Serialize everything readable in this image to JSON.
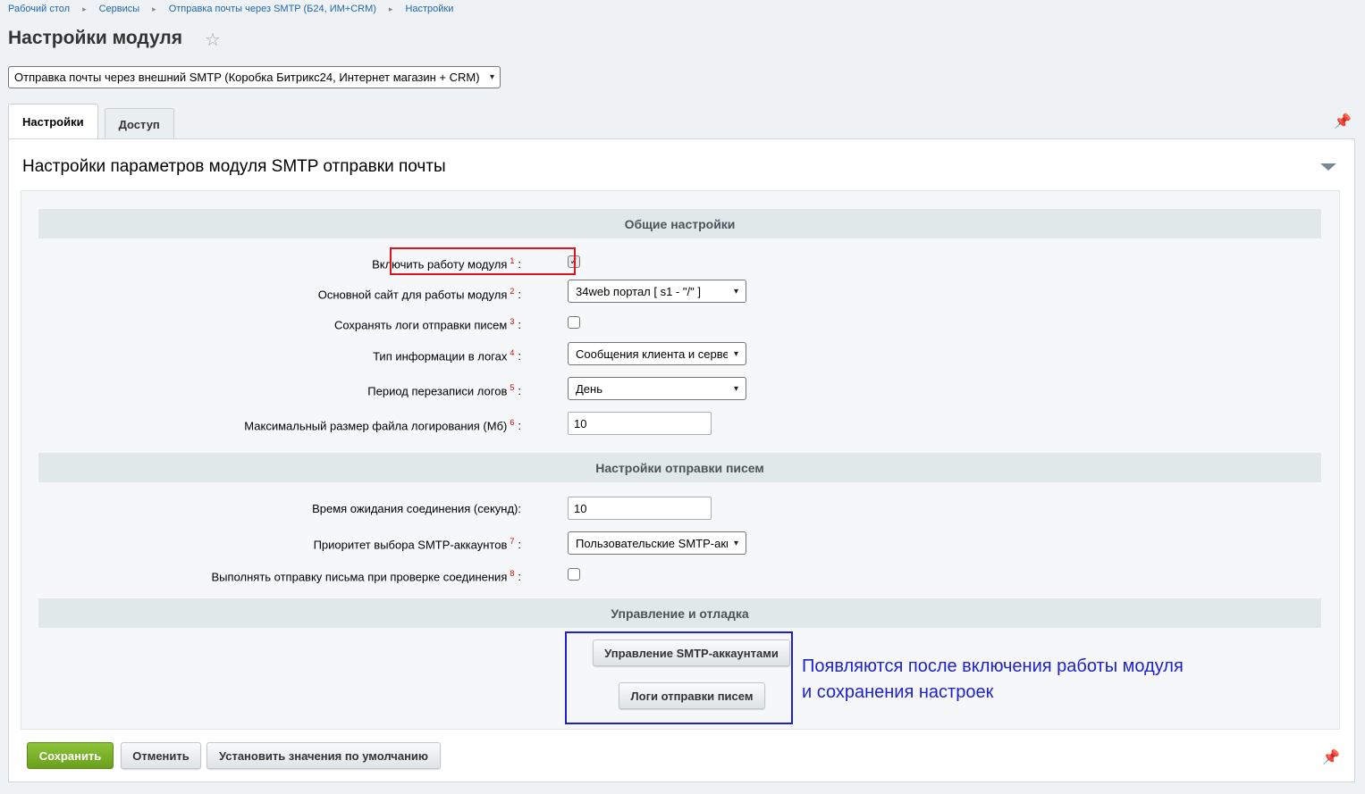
{
  "breadcrumb": {
    "items": [
      "Рабочий стол",
      "Сервисы",
      "Отправка почты через SMTP (Б24, ИМ+CRM)",
      "Настройки"
    ],
    "separator": "▸"
  },
  "page": {
    "title": "Настройки модуля",
    "favorite_icon": "star-icon"
  },
  "module_select": {
    "value": "Отправка почты через внешний SMTP (Коробка Битрикс24, Интернет магазин + CRM)"
  },
  "tabs": [
    {
      "label": "Настройки",
      "active": true
    },
    {
      "label": "Доступ",
      "active": false
    }
  ],
  "panel": {
    "title": "Настройки параметров модуля SMTP отправки почты"
  },
  "sections": {
    "general": "Общие настройки",
    "sending": "Настройки отправки писем",
    "management": "Управление и отладка"
  },
  "fields": {
    "enable": {
      "label": "Включить работу модуля",
      "note": "1",
      "checked": true
    },
    "site": {
      "label": "Основной сайт для работы модуля",
      "note": "2",
      "value": "34web портал [ s1 - \"/\" ]"
    },
    "save_logs": {
      "label": "Сохранять логи отправки писем",
      "note": "3",
      "checked": false
    },
    "log_type": {
      "label": "Тип информации в логах",
      "note": "4",
      "value": "Сообщения клиента и сервера"
    },
    "log_period": {
      "label": "Период перезаписи логов",
      "note": "5",
      "value": "День"
    },
    "log_max_size": {
      "label": "Максимальный размер файла логирования (Мб)",
      "note": "6",
      "value": "10"
    },
    "timeout": {
      "label": "Время ожидания соединения (секунд):",
      "value": "10"
    },
    "smtp_priority": {
      "label": "Приоритет выбора SMTP-аккаунтов",
      "note": "7",
      "value": "Пользовательские SMTP-аккаунты"
    },
    "test_send": {
      "label": "Выполнять отправку письма при проверке соединения",
      "note": "8",
      "checked": false
    }
  },
  "colon": ":",
  "management_buttons": {
    "accounts": "Управление SMTP-аккаунтами",
    "logs": "Логи отправки писем"
  },
  "annotation": {
    "line1": "Появляются после включения работы модуля",
    "line2": "и сохранения настроек"
  },
  "footer": {
    "save": "Сохранить",
    "cancel": "Отменить",
    "defaults": "Установить значения по умолчанию"
  },
  "colors": {
    "link": "#2067b0",
    "save_button": "#7ab42a",
    "red_highlight": "#e0141e",
    "blue_highlight": "#1f22cc",
    "section_header": "#e0e8ea"
  }
}
